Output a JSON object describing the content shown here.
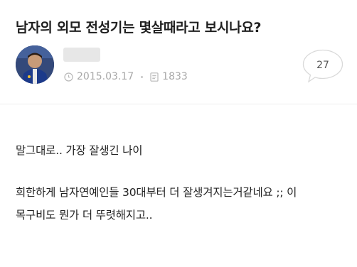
{
  "post": {
    "title": "남자의 외모 전성기는 몇살때라고 보시나요?",
    "author": {
      "name": "",
      "avatar_icon": "user-avatar-photo"
    },
    "meta": {
      "date_icon": "clock-icon",
      "date": "2015.03.17",
      "views_icon": "document-icon",
      "views": "1833"
    },
    "comments": {
      "icon": "speech-bubble-icon",
      "count": "27"
    },
    "body": [
      "말그대로.. 가장 잘생긴 나이",
      "희한하게 남자연예인들 30대부터 더 잘생겨지는거같네요 ;; 이",
      "목구비도 뭔가 더 뚜렷해지고.."
    ]
  },
  "colors": {
    "text": "#1f1f1f",
    "meta": "#a8a8a8",
    "divider": "#eeeeee",
    "avatar_bg": "#2b3d63"
  }
}
